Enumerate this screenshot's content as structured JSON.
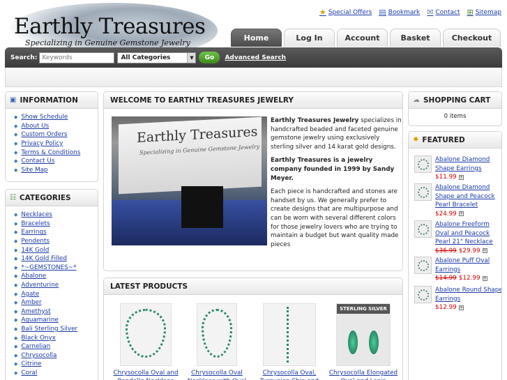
{
  "header": {
    "logo_title": "Earthly Treasures",
    "logo_subtitle": "Specializing in Genuine Gemstone Jewelry",
    "top_links": [
      {
        "label": "Special Offers",
        "icon": "star-icon"
      },
      {
        "label": "Bookmark",
        "icon": "bookmark-icon"
      },
      {
        "label": "Contact",
        "icon": "mail-icon"
      },
      {
        "label": "Sitemap",
        "icon": "sitemap-icon"
      }
    ],
    "tabs": [
      {
        "label": "Home",
        "active": true
      },
      {
        "label": "Log In",
        "active": false
      },
      {
        "label": "Account",
        "active": false
      },
      {
        "label": "Basket",
        "active": false
      },
      {
        "label": "Checkout",
        "active": false
      }
    ]
  },
  "search": {
    "label": "Search:",
    "placeholder": "Keywords",
    "category_selected": "All Categories",
    "go_label": "Go",
    "advanced_label": "Advanced Search"
  },
  "information": {
    "title": "INFORMATION",
    "items": [
      "Show Schedule",
      "About Us",
      "Custom Orders",
      "Privacy Policy",
      "Terms & Conditions",
      "Contact Us",
      "Site Map"
    ]
  },
  "categories": {
    "title": "CATEGORIES",
    "items": [
      "Necklaces",
      "Bracelets",
      "Earrings",
      "Pendents",
      "14K Gold",
      "14K Gold Filled",
      "*~GEMSTONES~*",
      "Abalone",
      "Adventurine",
      "Agate",
      "Amber",
      "Amethyst",
      "Aquamarine",
      "Bali Sterling Silver",
      "Black Onyx",
      "Carnelian",
      "Chrysocolla",
      "Citrine",
      "Coral"
    ]
  },
  "welcome": {
    "title": "WELCOME TO EARTHLY TREASURES JEWELRY",
    "image_sign": "Earthly Treasures",
    "image_sign_sub": "Specializing in Genuine Gemstone Jewelry",
    "p1_bold": "Earthly Treasures Jewelry",
    "p1_rest": " specializes in handcrafted beaded and faceted genuine gemstone jewelry using exclusively sterling silver and 14 karat gold designs.",
    "p2": "Earthly Treasures is a jewelry company founded in 1999 by Sandy Meyer.",
    "p3": "Each piece is handcrafted and stones are handset by us.  We generally prefer to create designs that are multipurpose and can be worn with several different colors for those jewelry lovers who are trying to maintain a budget but want quality made pieces"
  },
  "latest": {
    "title": "LATEST PRODUCTS",
    "products": [
      {
        "name": "Chrysocolla Oval and Rondelle Necklace",
        "kind": "necklace"
      },
      {
        "name": "Chrysocolla Oval Necklace with Oval Drop",
        "kind": "necklace"
      },
      {
        "name": "Chrysocolla Oval, Turquoise Chip and",
        "kind": "strand"
      },
      {
        "name": "Chrysocolla Elongated Oval and Lapis Earrings",
        "kind": "earrings",
        "tag": "STERLING SILVER"
      }
    ]
  },
  "cart": {
    "title": "SHOPPING CART",
    "status": "0 items"
  },
  "featured": {
    "title": "FEATURED",
    "items": [
      {
        "name": "Abalone Diamond Shape Earrings",
        "old_price": "",
        "price": "$11.99"
      },
      {
        "name": "Abalone Diamond Shape and Peacock Pearl Bracelet",
        "old_price": "",
        "price": "$24.99"
      },
      {
        "name": "Abalone Freeform Oval and Peacock Pearl 21\" Necklace",
        "old_price": "$36.99",
        "price": "$29.99"
      },
      {
        "name": "Abalone Puff Oval Earrings",
        "old_price": "$14.99",
        "price": "$12.99"
      },
      {
        "name": "Abalone Round Shape Earrings",
        "old_price": "",
        "price": "$12.99"
      }
    ]
  },
  "colors": {
    "link": "#1a3aa8",
    "price": "#cc0000",
    "go_button": "#3d8a1c",
    "search_bar": "#3c3c3c"
  }
}
